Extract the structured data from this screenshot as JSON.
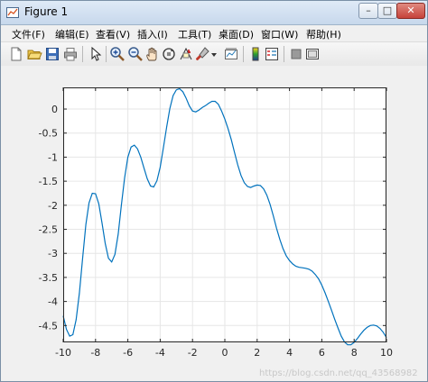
{
  "window": {
    "title": "Figure 1",
    "controls": {
      "minimize": "–",
      "maximize": "□",
      "close": "✕"
    }
  },
  "menubar": {
    "items": [
      {
        "id": "file",
        "label": "文件(F)"
      },
      {
        "id": "edit",
        "label": "编辑(E)"
      },
      {
        "id": "view",
        "label": "查看(V)"
      },
      {
        "id": "insert",
        "label": "插入(I)"
      },
      {
        "id": "tools",
        "label": "工具(T)"
      },
      {
        "id": "desktop",
        "label": "桌面(D)"
      },
      {
        "id": "window",
        "label": "窗口(W)"
      },
      {
        "id": "help",
        "label": "帮助(H)"
      }
    ]
  },
  "toolbar": {
    "buttons": [
      {
        "icon": "new-figure-icon"
      },
      {
        "icon": "open-file-icon"
      },
      {
        "icon": "save-icon"
      },
      {
        "icon": "print-icon"
      },
      {
        "icon": "pointer-icon"
      },
      {
        "icon": "zoom-in-icon"
      },
      {
        "icon": "zoom-out-icon"
      },
      {
        "icon": "pan-hand-icon"
      },
      {
        "icon": "rotate-3d-icon"
      },
      {
        "icon": "data-cursor-icon"
      },
      {
        "icon": "brush-icon"
      },
      {
        "icon": "brush-dropdown-icon"
      },
      {
        "icon": "link-plot-icon"
      },
      {
        "icon": "insert-colorbar-icon"
      },
      {
        "icon": "insert-legend-icon"
      },
      {
        "icon": "hide-plot-tools-icon"
      },
      {
        "icon": "show-plot-tools-icon"
      }
    ]
  },
  "watermark": "https://blog.csdn.net/qq_43568982",
  "chart_data": {
    "type": "line",
    "title": "",
    "xlabel": "",
    "ylabel": "",
    "xlim": [
      -10,
      10
    ],
    "ylim": [
      -4.85,
      0.45
    ],
    "xticks": [
      "-10",
      "-8",
      "-6",
      "-4",
      "-2",
      "0",
      "2",
      "4",
      "6",
      "8",
      "10"
    ],
    "yticks": [
      "0",
      "-0.5",
      "-1",
      "-1.5",
      "-2",
      "-2.5",
      "-3",
      "-3.5",
      "-4",
      "-4.5"
    ],
    "grid": true,
    "color": "#0072bd",
    "series": [
      {
        "x": [
          -10,
          -9.8,
          -9.6,
          -9.4,
          -9.2,
          -9,
          -8.8,
          -8.6,
          -8.4,
          -8.2,
          -8,
          -7.8,
          -7.6,
          -7.4,
          -7.2,
          -7,
          -6.8,
          -6.6,
          -6.4,
          -6.2,
          -6,
          -5.8,
          -5.6,
          -5.4,
          -5.2,
          -5,
          -4.8,
          -4.6,
          -4.4,
          -4.2,
          -4,
          -3.8,
          -3.6,
          -3.4,
          -3.2,
          -3,
          -2.8,
          -2.6,
          -2.4,
          -2.2,
          -2,
          -1.8,
          -1.6,
          -1.4,
          -1.2,
          -1,
          -0.8,
          -0.6,
          -0.4,
          -0.2,
          0,
          0.2,
          0.4,
          0.6,
          0.8,
          1,
          1.2,
          1.4,
          1.6,
          1.8,
          2,
          2.2,
          2.4,
          2.6,
          2.8,
          3,
          3.2,
          3.4,
          3.6,
          3.8,
          4,
          4.2,
          4.4,
          4.6,
          4.8,
          5,
          5.2,
          5.4,
          5.6,
          5.8,
          6,
          6.2,
          6.4,
          6.6,
          6.8,
          7,
          7.2,
          7.4,
          7.6,
          7.8,
          8,
          8.2,
          8.4,
          8.6,
          8.8,
          9,
          9.2,
          9.4,
          9.6,
          9.8,
          10
        ],
        "y": [
          -4.3,
          -4.58,
          -4.72,
          -4.69,
          -4.38,
          -3.83,
          -3.1,
          -2.4,
          -1.95,
          -1.75,
          -1.76,
          -1.97,
          -2.37,
          -2.79,
          -3.1,
          -3.18,
          -3.02,
          -2.6,
          -2.0,
          -1.43,
          -1.0,
          -0.79,
          -0.75,
          -0.83,
          -1.0,
          -1.23,
          -1.45,
          -1.6,
          -1.62,
          -1.49,
          -1.21,
          -0.8,
          -0.37,
          0.01,
          0.28,
          0.4,
          0.42,
          0.36,
          0.23,
          0.07,
          -0.04,
          -0.06,
          -0.02,
          0.03,
          0.07,
          0.12,
          0.16,
          0.16,
          0.1,
          -0.04,
          -0.21,
          -0.41,
          -0.64,
          -0.9,
          -1.16,
          -1.38,
          -1.53,
          -1.61,
          -1.63,
          -1.6,
          -1.58,
          -1.59,
          -1.66,
          -1.79,
          -1.98,
          -2.22,
          -2.48,
          -2.71,
          -2.9,
          -3.05,
          -3.15,
          -3.22,
          -3.27,
          -3.29,
          -3.3,
          -3.31,
          -3.33,
          -3.37,
          -3.44,
          -3.53,
          -3.66,
          -3.82,
          -4.0,
          -4.18,
          -4.37,
          -4.55,
          -4.72,
          -4.84,
          -4.9,
          -4.9,
          -4.85,
          -4.77,
          -4.68,
          -4.6,
          -4.54,
          -4.5,
          -4.49,
          -4.51,
          -4.56,
          -4.64,
          -4.75
        ]
      }
    ]
  }
}
